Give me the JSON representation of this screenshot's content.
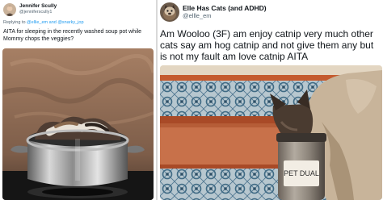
{
  "left_tweet": {
    "display_name": "Jennifer Scully",
    "handle": "@jenniferscully1",
    "reply_prefix": "Replying to ",
    "reply_mentions": "@ellie_em and @snarky_jop",
    "text": "AITA for sleeping in the recently washed soup pot while Mommy chops the veggies?",
    "image_subject": "cat-sleeping-in-steel-pot"
  },
  "right_tweet": {
    "display_name": "Elle Has Cats (and ADHD)",
    "handle": "@ellle_em",
    "text": "Am Wooloo (3F) am enjoy catnip very much other cats say am hog catnip and not give them any but is not my fault am love catnip AITA",
    "image_subject": "cat-with-head-in-catnip-jar",
    "jar_label": "PET DUAL"
  },
  "colors": {
    "handle_gray": "#536471",
    "mention_blue": "#1d9bf0",
    "text": "#0f1419"
  }
}
